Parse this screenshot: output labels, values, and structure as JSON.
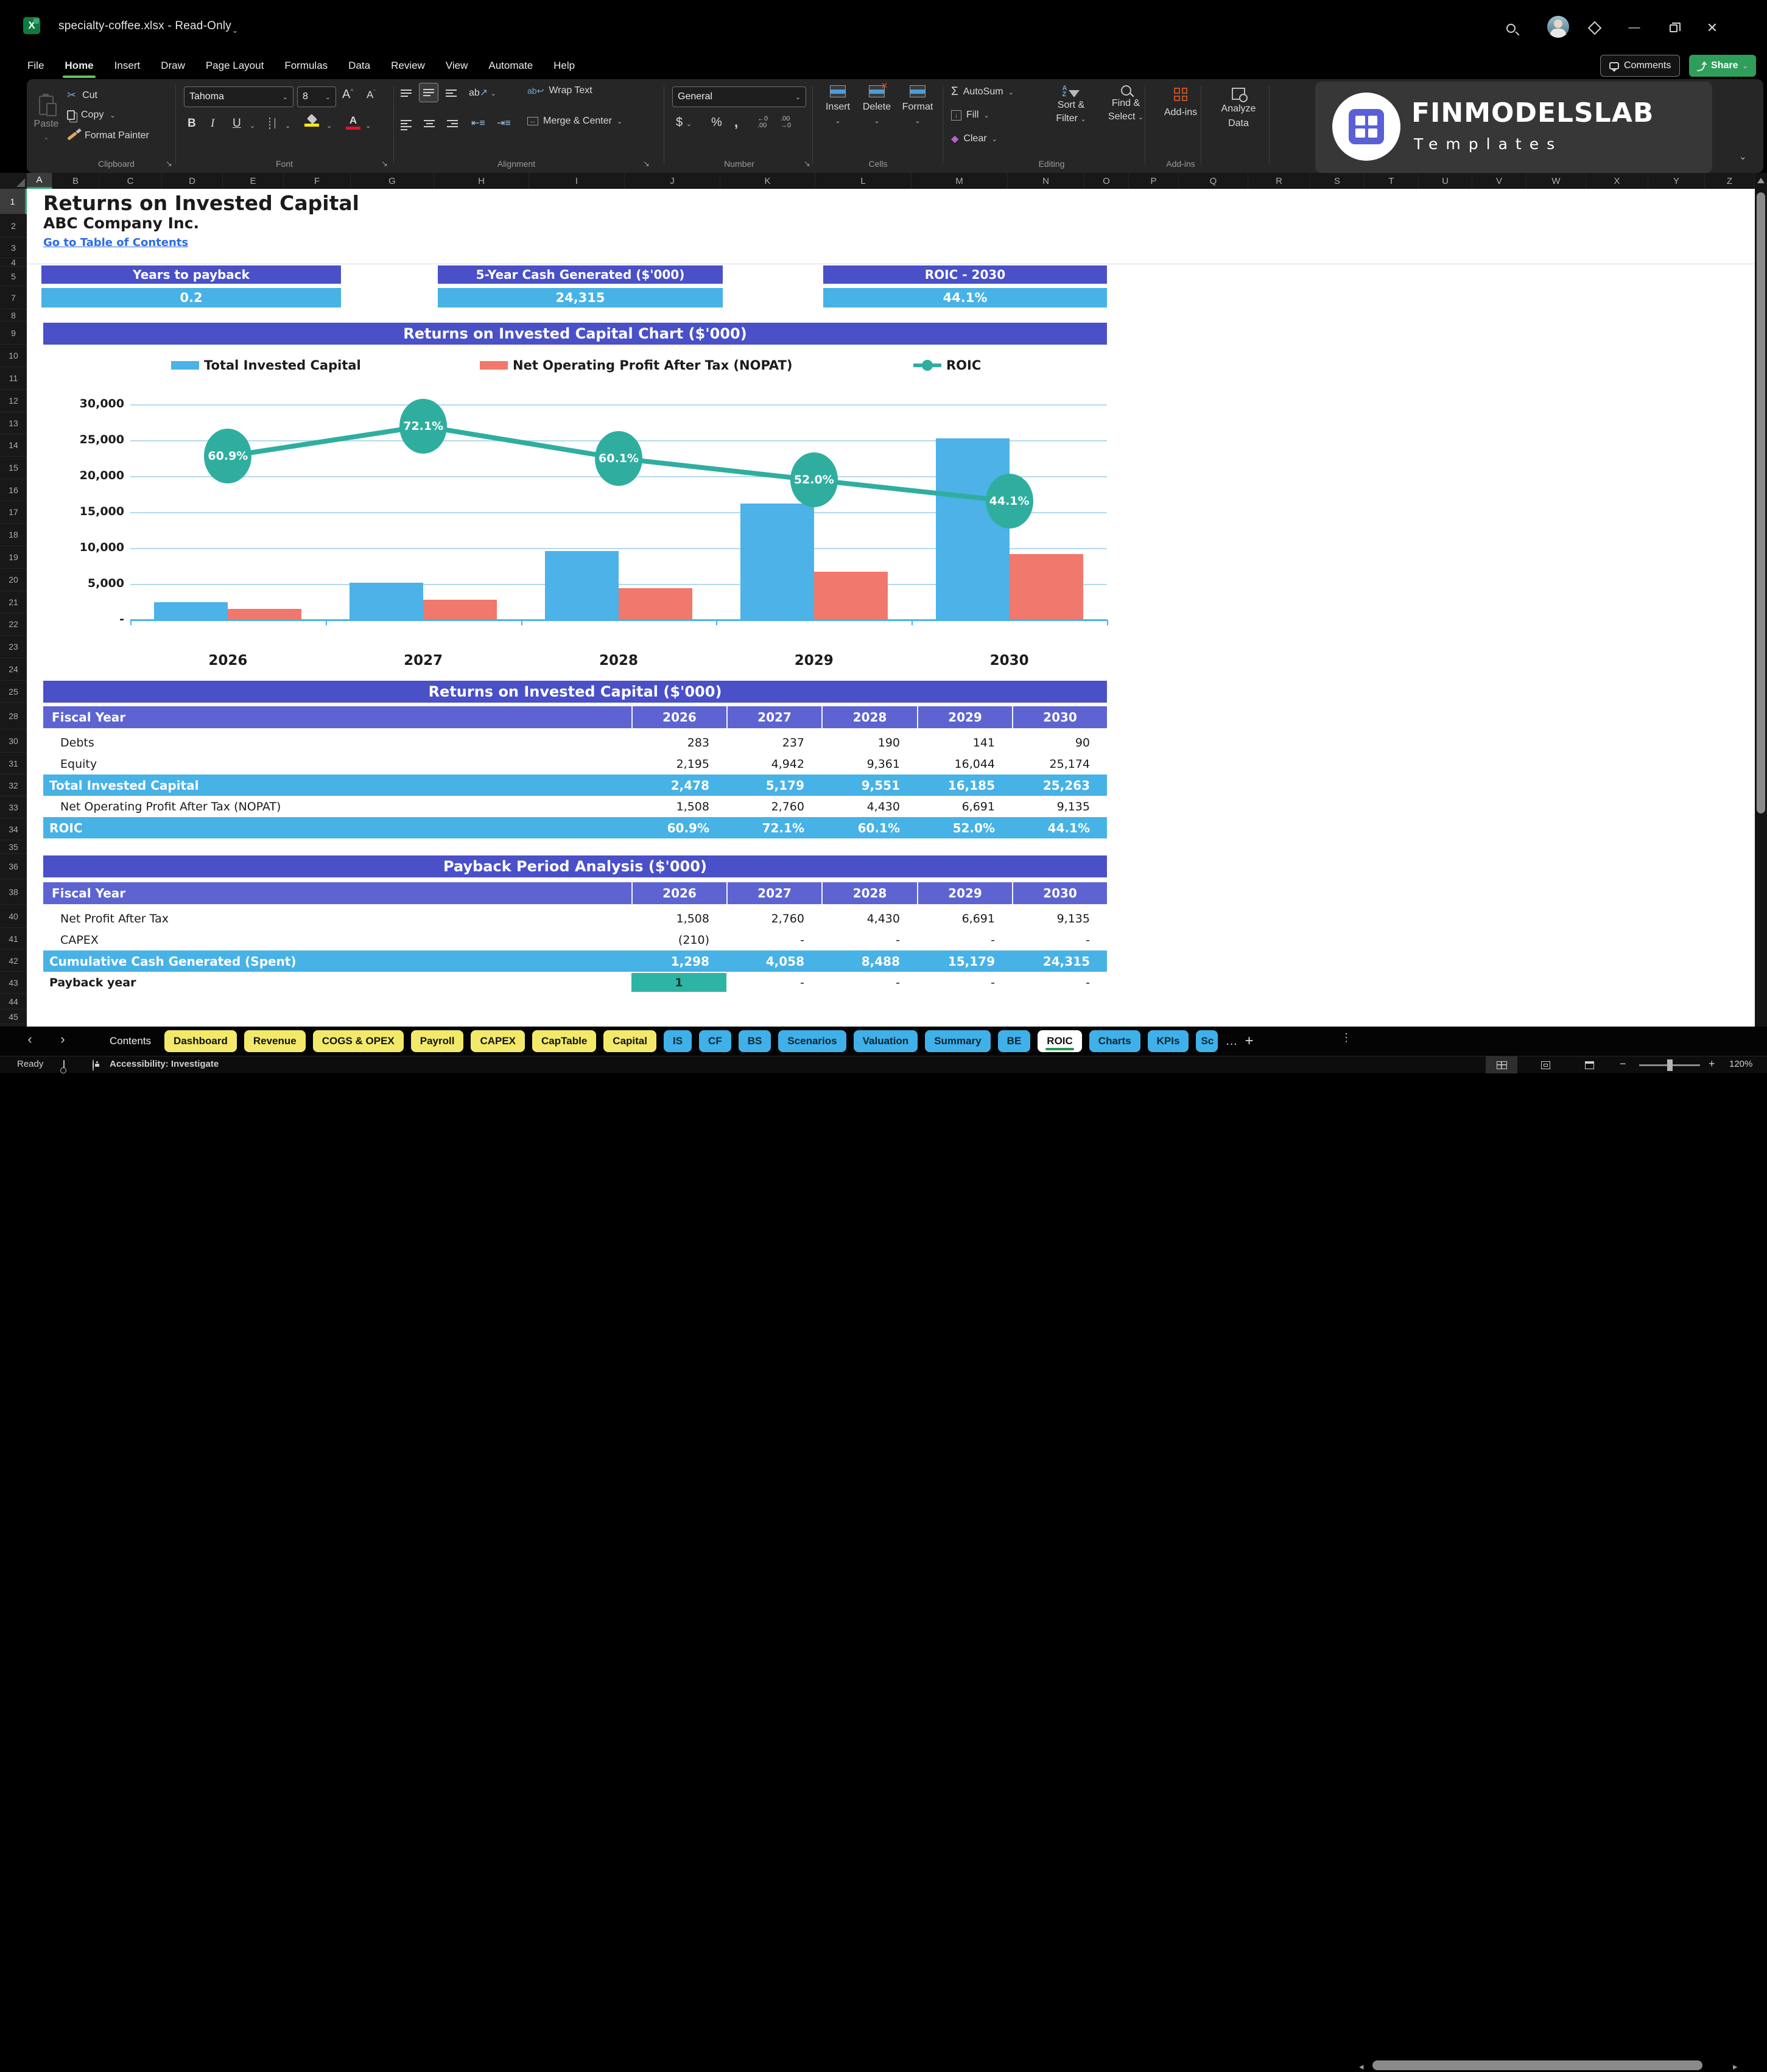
{
  "window": {
    "title": "specialty-coffee.xlsx  -  Read-Only"
  },
  "menu": {
    "items": [
      "File",
      "Home",
      "Insert",
      "Draw",
      "Page Layout",
      "Formulas",
      "Data",
      "Review",
      "View",
      "Automate",
      "Help"
    ],
    "active": "Home"
  },
  "top_right": {
    "comments": "Comments",
    "share": "Share"
  },
  "ribbon": {
    "clipboard": {
      "label": "Clipboard",
      "paste": "Paste",
      "cut": "Cut",
      "copy": "Copy",
      "format_painter": "Format Painter"
    },
    "font": {
      "label": "Font",
      "font_name": "Tahoma",
      "font_size": "8"
    },
    "alignment": {
      "label": "Alignment",
      "wrap_text": "Wrap Text",
      "merge_center": "Merge & Center"
    },
    "number": {
      "label": "Number",
      "format": "General"
    },
    "cells": {
      "label": "Cells",
      "insert": "Insert",
      "delete": "Delete",
      "format": "Format"
    },
    "editing": {
      "label": "Editing",
      "autosum": "AutoSum",
      "fill": "Fill",
      "clear": "Clear",
      "sort_line1": "Sort &",
      "sort_line2": "Filter",
      "find_line1": "Find &",
      "find_line2": "Select"
    },
    "addins": {
      "label": "Add-ins",
      "addins": "Add-ins",
      "analyze_line1": "Analyze",
      "analyze_line2": "Data"
    }
  },
  "logo": {
    "line1": "FINMODELSLAB",
    "line2": "Templates"
  },
  "grid": {
    "columns": [
      "A",
      "B",
      "C",
      "D",
      "E",
      "F",
      "G",
      "H",
      "I",
      "J",
      "K",
      "L",
      "M",
      "N",
      "O",
      "P",
      "Q",
      "R",
      "S",
      "T",
      "U",
      "V",
      "W",
      "X",
      "Y",
      "Z"
    ],
    "rows": [
      1,
      2,
      3,
      4,
      5,
      7,
      8,
      9,
      10,
      11,
      12,
      13,
      14,
      15,
      16,
      17,
      18,
      19,
      20,
      21,
      22,
      23,
      24,
      25,
      28,
      30,
      31,
      32,
      33,
      34,
      35,
      36,
      38,
      40,
      41,
      42,
      43,
      44,
      45
    ]
  },
  "sheet": {
    "title": "Returns on Invested Capital",
    "company": "ABC Company Inc.",
    "toc_link": "Go to Table of Contents",
    "kpis": [
      {
        "label": "Years to payback",
        "value": "0.2"
      },
      {
        "label": "5-Year Cash Generated ($'000)",
        "value": "24,315"
      },
      {
        "label": "ROIC - 2030",
        "value": "44.1%"
      }
    ]
  },
  "chart_data": {
    "type": "bar+line",
    "title": "Returns on Invested Capital Chart ($'000)",
    "categories": [
      "2026",
      "2027",
      "2028",
      "2029",
      "2030"
    ],
    "series": [
      {
        "name": "Total Invested Capital",
        "type": "bar",
        "color": "#4cb2e8",
        "values": [
          2478,
          5179,
          9551,
          16185,
          25263
        ]
      },
      {
        "name": "Net Operating Profit After Tax (NOPAT)",
        "type": "bar",
        "color": "#f0786c",
        "values": [
          1508,
          2760,
          4430,
          6691,
          9135
        ]
      },
      {
        "name": "ROIC",
        "type": "line",
        "color": "#2fae9f",
        "values_pct": [
          60.9,
          72.1,
          60.1,
          52.0,
          44.1
        ],
        "labels": [
          "60.9%",
          "72.1%",
          "60.1%",
          "52.0%",
          "44.1%"
        ]
      }
    ],
    "y_ticks": [
      "30,000",
      "25,000",
      "20,000",
      "15,000",
      "10,000",
      "5,000",
      "-"
    ],
    "ylim": [
      0,
      30000
    ],
    "grid": true,
    "legend_position": "top"
  },
  "table1": {
    "title": "Returns on Invested Capital ($'000)",
    "header": {
      "label": "Fiscal Year",
      "years": [
        "2026",
        "2027",
        "2028",
        "2029",
        "2030"
      ]
    },
    "rows": [
      {
        "label": "Debts",
        "values": [
          "283",
          "237",
          "190",
          "141",
          "90"
        ],
        "style": "plain"
      },
      {
        "label": "Equity",
        "values": [
          "2,195",
          "4,942",
          "9,361",
          "16,044",
          "25,174"
        ],
        "style": "plain"
      },
      {
        "label": "Total Invested Capital",
        "values": [
          "2,478",
          "5,179",
          "9,551",
          "16,185",
          "25,263"
        ],
        "style": "highlight"
      },
      {
        "label": "Net Operating Profit After Tax (NOPAT)",
        "values": [
          "1,508",
          "2,760",
          "4,430",
          "6,691",
          "9,135"
        ],
        "style": "plain"
      },
      {
        "label": "ROIC",
        "values": [
          "60.9%",
          "72.1%",
          "60.1%",
          "52.0%",
          "44.1%"
        ],
        "style": "highlight"
      }
    ]
  },
  "table2": {
    "title": "Payback Period Analysis ($'000)",
    "header": {
      "label": "Fiscal Year",
      "years": [
        "2026",
        "2027",
        "2028",
        "2029",
        "2030"
      ]
    },
    "rows": [
      {
        "label": "Net Profit After Tax",
        "values": [
          "1,508",
          "2,760",
          "4,430",
          "6,691",
          "9,135"
        ],
        "style": "plain"
      },
      {
        "label": "CAPEX",
        "values": [
          "(210)",
          "-",
          "-",
          "-",
          "-"
        ],
        "style": "plain"
      },
      {
        "label": "Cumulative Cash Generated (Spent)",
        "values": [
          "1,298",
          "4,058",
          "8,488",
          "15,179",
          "24,315"
        ],
        "style": "highlight"
      },
      {
        "label": "Payback year",
        "values": [
          "1",
          "-",
          "-",
          "-",
          "-"
        ],
        "style": "payback"
      }
    ]
  },
  "sheet_tabs": {
    "tabs": [
      {
        "label": "Contents",
        "style": "plain"
      },
      {
        "label": "Dashboard",
        "style": "yellow"
      },
      {
        "label": "Revenue",
        "style": "yellow"
      },
      {
        "label": "COGS & OPEX",
        "style": "yellow"
      },
      {
        "label": "Payroll",
        "style": "yellow"
      },
      {
        "label": "CAPEX",
        "style": "yellow"
      },
      {
        "label": "CapTable",
        "style": "yellow"
      },
      {
        "label": "Capital",
        "style": "yellow"
      },
      {
        "label": "IS",
        "style": "blue"
      },
      {
        "label": "CF",
        "style": "blue"
      },
      {
        "label": "BS",
        "style": "blue"
      },
      {
        "label": "Scenarios",
        "style": "blue"
      },
      {
        "label": "Valuation",
        "style": "blue"
      },
      {
        "label": "Summary",
        "style": "blue"
      },
      {
        "label": "BE",
        "style": "blue"
      },
      {
        "label": "ROIC",
        "style": "active"
      },
      {
        "label": "Charts",
        "style": "blue"
      },
      {
        "label": "KPIs",
        "style": "blue"
      },
      {
        "label": "Sc",
        "style": "blue",
        "truncated": true
      }
    ],
    "overflow": "…",
    "add": "+",
    "more": "⋮"
  },
  "status_bar": {
    "ready": "Ready",
    "accessibility": "Accessibility: Investigate",
    "zoom": "120%"
  },
  "colors": {
    "banner": "#4a50c8",
    "table_header": "#5d64d2",
    "highlight_row": "#47b2e6",
    "payback_cell": "#2db4a4",
    "bar_blue": "#4cb2e8",
    "bar_red": "#f0786c",
    "line_teal": "#2fae9f",
    "tab_yellow": "#f2e96b",
    "tab_blue": "#3fb0e8",
    "share_green": "#2f9e5a",
    "active_tab_underline": "#1f9e4c",
    "link_blue": "#2b6be6"
  }
}
